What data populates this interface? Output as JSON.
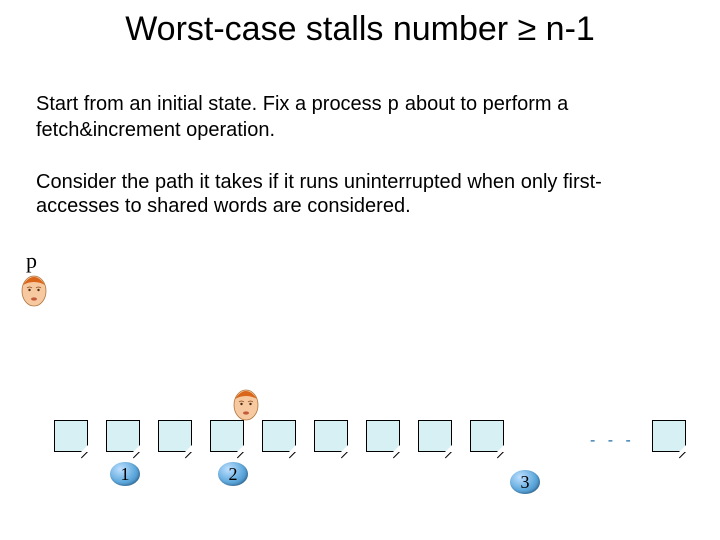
{
  "title": "Worst-case stalls number ≥  n-1",
  "para1_a": "Start from an initial state. Fix a process ",
  "para1_p": "p",
  "para1_b": "  about to perform  a fetch&increment operation.",
  "para2": "Consider the path it takes if it runs uninterrupted when only first-accesses to shared words are considered.",
  "p_label": "p",
  "dots": "- - -",
  "num1": "1",
  "num2": "2",
  "num3": "3"
}
